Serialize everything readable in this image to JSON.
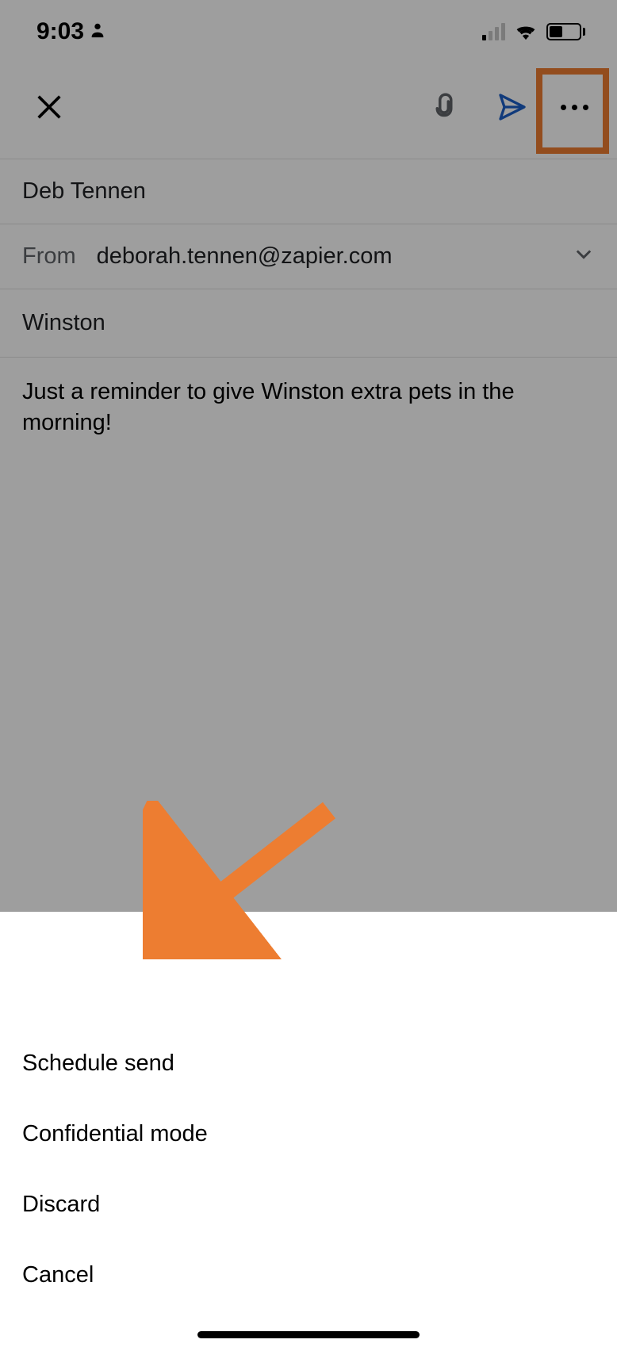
{
  "status": {
    "time": "9:03"
  },
  "compose": {
    "to_name": "Deb Tennen",
    "from_label": "From",
    "from_address": "deborah.tennen@zapier.com",
    "subject": "Winston",
    "body": "Just a reminder to give Winston extra pets in the morning!"
  },
  "sheet": {
    "items": [
      {
        "label": "Schedule send"
      },
      {
        "label": "Confidential mode"
      },
      {
        "label": "Discard"
      },
      {
        "label": "Cancel"
      }
    ]
  },
  "colors": {
    "highlight": "#ed7d31",
    "send_blue": "#1a73e8"
  }
}
